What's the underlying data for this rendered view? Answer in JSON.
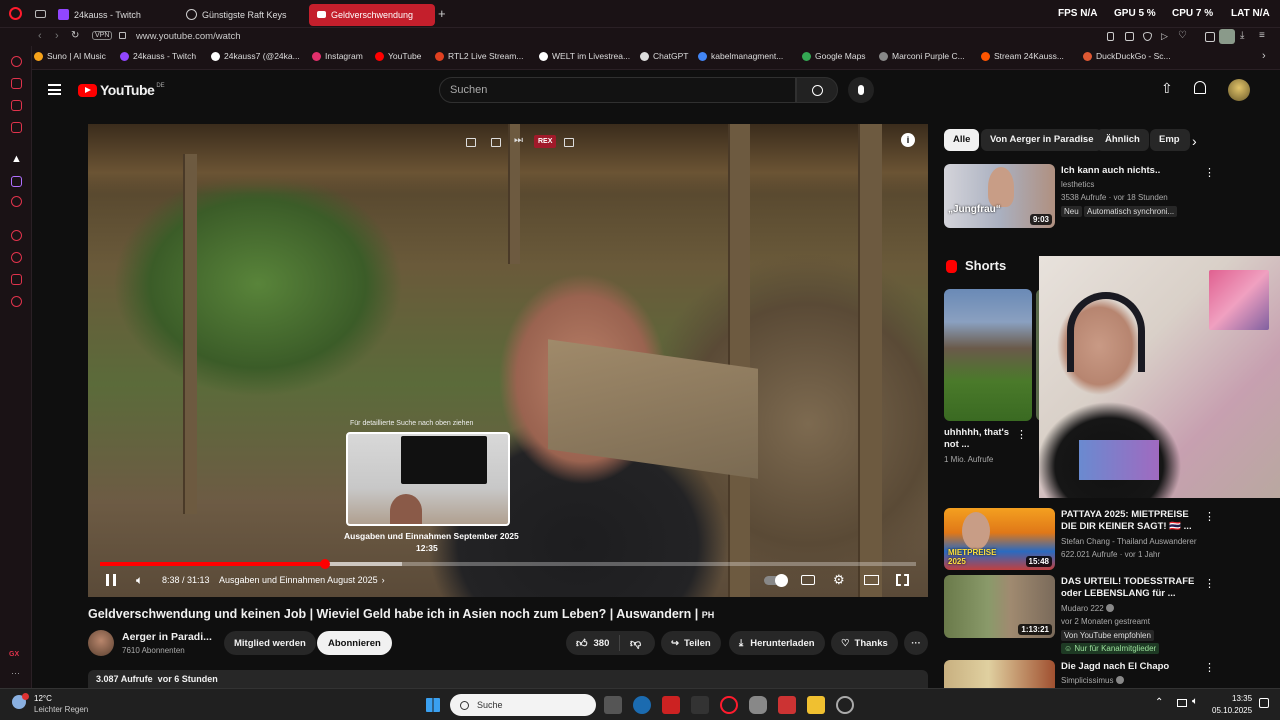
{
  "browser": {
    "tabs": [
      {
        "label": "24kauss - Twitch"
      },
      {
        "label": "Günstigste Raft Keys"
      },
      {
        "label": "Geldverschwendung"
      }
    ],
    "stats": {
      "fps_label": "FPS",
      "fps": "N/A",
      "gpu_label": "GPU",
      "gpu": "5 %",
      "cpu_label": "CPU",
      "cpu": "7 %",
      "lat_label": "LAT",
      "lat": "N/A"
    },
    "vpn": "VPN",
    "url": "www.youtube.com/watch",
    "bookmarks": [
      {
        "label": "Suno | AI Music",
        "color": "#f6a21a"
      },
      {
        "label": "24kauss - Twitch",
        "color": "#9146ff"
      },
      {
        "label": "24kauss7 (@24ka...",
        "color": "#ffffff"
      },
      {
        "label": "Instagram",
        "color": "#e1306c"
      },
      {
        "label": "YouTube",
        "color": "#ff0000"
      },
      {
        "label": "RTL2 Live Stream...",
        "color": "#e04020"
      },
      {
        "label": "WELT im Livestrea...",
        "color": "#ffffff"
      },
      {
        "label": "ChatGPT",
        "color": "#dddddd"
      },
      {
        "label": "kabelmanagment...",
        "color": "#4285f4"
      },
      {
        "label": "Google Maps",
        "color": "#34a853"
      },
      {
        "label": "Marconi Purple C...",
        "color": "#888888"
      },
      {
        "label": "Stream 24Kauss...",
        "color": "#ff5500"
      },
      {
        "label": "DuckDuckGo - Sc...",
        "color": "#de5833"
      }
    ]
  },
  "youtube": {
    "logo": "YouTube",
    "region": "DE",
    "search_placeholder": "Suchen",
    "player": {
      "preview_hint": "Für detaillierte Suche nach oben ziehen",
      "preview_chapter": "Ausgaben und Einnahmen September 2025",
      "preview_time": "12:35",
      "current_time": "8:38 / 31:13",
      "chapter": "Ausgaben und Einnahmen August 2025",
      "progress": 0.276,
      "buffered": 0.37,
      "top_badge": "REX"
    },
    "title": "Geldverschwendung und keinen Job | Wieviel Geld habe ich in Asien noch zum Leben? | Auswandern |",
    "title_badge": "PH",
    "channel": {
      "name": "Aerger in Paradi...",
      "subs": "7610 Abonnenten"
    },
    "buttons": {
      "member": "Mitglied werden",
      "subscribe": "Abonnieren",
      "likes": "380",
      "share": "Teilen",
      "download": "Herunterladen",
      "thanks": "Thanks"
    },
    "views": "3.087 Aufrufe  vor 6 Stunden",
    "chips": [
      "Alle",
      "Von Aerger in Paradise",
      "Ähnlich",
      "Emp"
    ],
    "shorts_label": "Shorts",
    "short": {
      "title": "uhhhhh, that's not ...",
      "views": "1 Mio. Aufrufe"
    },
    "videos": [
      {
        "title": "Ich kann auch nichts..",
        "channel": "lesthetics",
        "meta": "3538 Aufrufe · vor 18 Stunden",
        "badge1": "Neu",
        "badge2": "Automatisch synchroni...",
        "duration": "9:03",
        "thumb_text": "„Jungfrau“"
      },
      {
        "title": "PATTAYA 2025: MIETPREISE DIE DIR KEINER SAGT! 🇹🇭 ...",
        "channel": "Stefan Chang - Thailand Auswanderer",
        "meta": "622.021 Aufrufe · vor 1 Jahr",
        "duration": "15:48",
        "thumb_text": "MIETPREISE 2025"
      },
      {
        "title": "DAS URTEIL! TODESSTRAFE oder LEBENSLANG für ...",
        "channel": "Mudaro 222",
        "meta": "vor 2 Monaten gestreamt",
        "badge1": "Von YouTube empfohlen",
        "badge2": "Nur für Kanalmitglieder",
        "duration": "1:13:21"
      },
      {
        "title": "Die Jagd nach El Chapo",
        "channel": "Simplicissimus",
        "meta": ""
      }
    ]
  },
  "taskbar": {
    "weather_temp": "12°C",
    "weather_desc": "Leichter Regen",
    "search": "Suche",
    "time": "13:35",
    "date": "05.10.2025"
  }
}
